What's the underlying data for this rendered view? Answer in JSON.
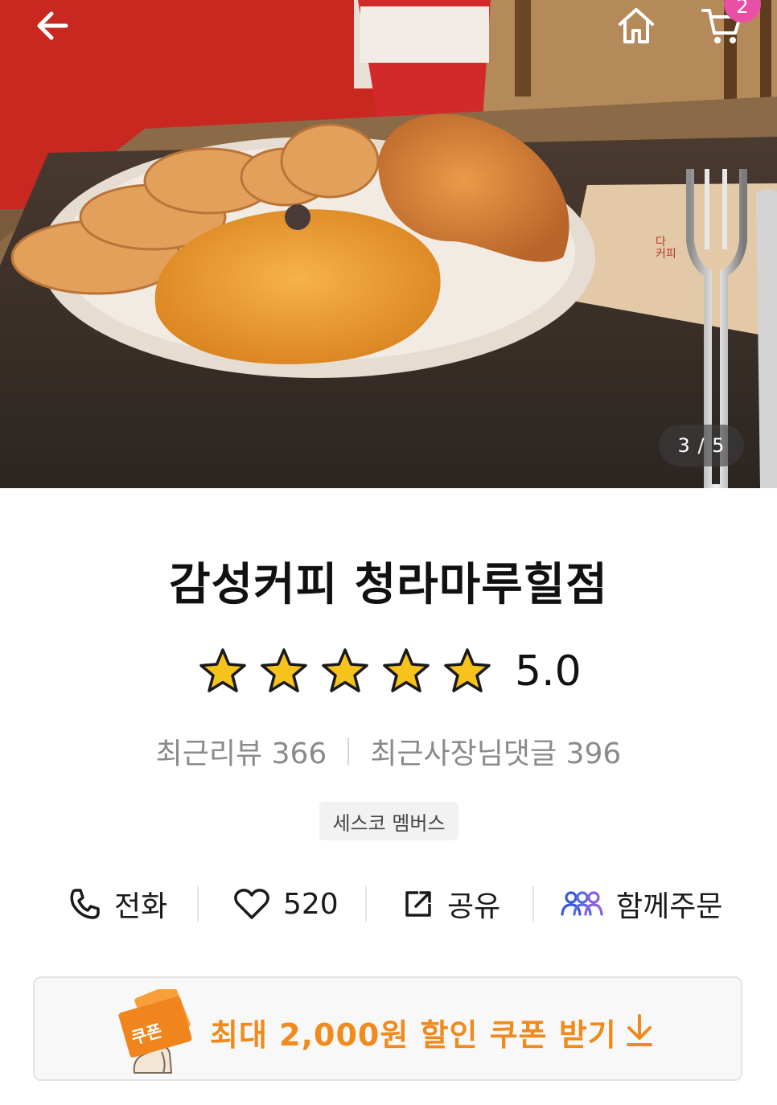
{
  "header": {
    "back_icon": "arrow-left-icon",
    "home_icon": "home-icon",
    "cart_icon": "cart-icon",
    "cart_count": "2"
  },
  "gallery": {
    "counter": "3 / 5"
  },
  "store": {
    "name": "감성커피 청라마루힐점",
    "rating": "5.0",
    "rating_stars": 5,
    "recent_reviews": "최근리뷰 366",
    "owner_replies": "최근사장님댓글 396",
    "member_tag": "세스코 멤버스"
  },
  "actions": {
    "call": "전화",
    "like_count": "520",
    "share": "공유",
    "group_order": "함께주문"
  },
  "coupon": {
    "icon_label": "쿠폰",
    "text": "최대 2,000원 할인 쿠폰 받기"
  },
  "colors": {
    "accent_orange": "#f08a1c",
    "badge_pink": "#e94fa5",
    "group_icon_blue": "#3a5bd9",
    "star_yellow": "#f6c21c"
  }
}
